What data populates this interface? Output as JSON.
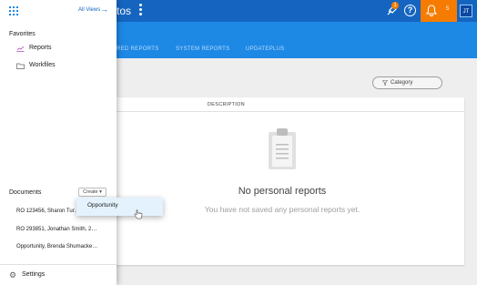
{
  "header": {
    "title_fragment": "tos",
    "rocket_badge": "1",
    "bell_count": "5",
    "avatar_initials": "JT"
  },
  "tabs": [
    {
      "label": "RED REPORTS"
    },
    {
      "label": "SYSTEM REPORTS"
    },
    {
      "label": "UPDATEPLUS"
    }
  ],
  "filter": {
    "label": "Category"
  },
  "table": {
    "column_description": "DESCRIPTION"
  },
  "empty_state": {
    "title": "No personal reports",
    "subtitle": "You have not saved any personal reports yet."
  },
  "drawer": {
    "all_views_label": "All Views",
    "favorites_heading": "Favorites",
    "favorites": [
      {
        "label": "Reports",
        "icon": "reports-icon"
      },
      {
        "label": "Workfiles",
        "icon": "folder-icon"
      }
    ],
    "documents_heading": "Documents",
    "create_label": "Create ▾",
    "documents": [
      {
        "label": "RO 123456, Sharon Tur…"
      },
      {
        "label": "RO 293851, Jonathan Smith, 2…"
      },
      {
        "label": "Opportunity, Brenda Shumacke…"
      }
    ],
    "settings_label": "Settings"
  },
  "create_menu": {
    "items": [
      {
        "label": "Opportunity"
      }
    ]
  },
  "colors": {
    "topbar": "#1565c0",
    "tabsbar": "#1e88e5",
    "accent_orange": "#f57c00"
  }
}
